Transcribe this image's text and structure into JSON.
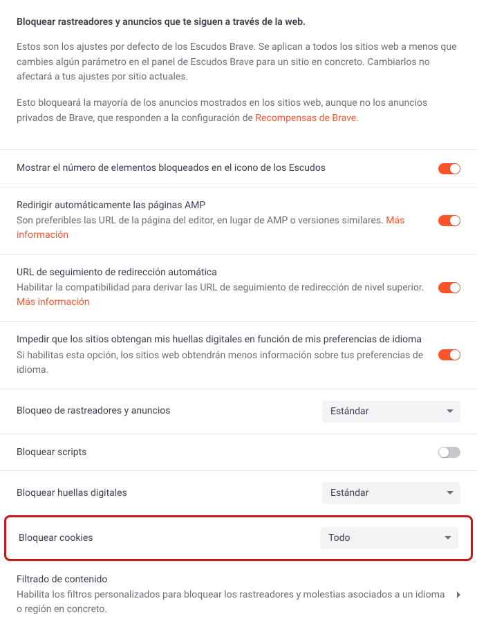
{
  "intro": {
    "title": "Bloquear rastreadores y anuncios que te siguen a través de la web.",
    "p1": "Estos son los ajustes por defecto de los Escudos Brave. Se aplican a todos los sitios web a menos que cambies algún parámetro en el panel de Escudos Brave para un sitio en concreto. Cambiarlos no afectará a tus ajustes por sitio actuales.",
    "p2_prefix": "Esto bloqueará la mayoría de los anuncios mostrados en los sitios web, aunque no los anuncios privados de Brave, que responden a la configuración de ",
    "p2_link": "Recompensas de Brave."
  },
  "rows": {
    "showCount": {
      "label": "Mostrar el número de elementos bloqueados en el icono de los Escudos",
      "on": true
    },
    "amp": {
      "label": "Redirigir automáticamente las páginas AMP",
      "desc_prefix": "Son preferibles las URL de la página del editor, en lugar de AMP o versiones similares. ",
      "desc_link": "Más información",
      "on": true
    },
    "redirect": {
      "label": "URL de seguimiento de redirección automática",
      "desc_prefix": "Habilitar la compatibilidad para derivar las URL de seguimiento de redirección de nivel superior. ",
      "desc_link": "Más información",
      "on": true
    },
    "fingerprintLang": {
      "label": "Impedir que los sitios obtengan mis huellas digitales en función de mis preferencias de idioma",
      "desc": "Si habilitas esta opción, los sitios web obtendrán menos información sobre tus preferencias de idioma.",
      "on": true
    },
    "trackersAds": {
      "label": "Bloqueo de rastreadores y anuncios",
      "value": "Estándar"
    },
    "scripts": {
      "label": "Bloquear scripts",
      "on": false
    },
    "fingerprints": {
      "label": "Bloquear huellas digitales",
      "value": "Estándar"
    },
    "cookies": {
      "label": "Bloquear cookies",
      "value": "Todo"
    },
    "contentFilter": {
      "label": "Filtrado de contenido",
      "desc": "Habilita los filtros personalizados para bloquear los rastreadores y molestias asociados a un idioma o región en concreto."
    }
  }
}
